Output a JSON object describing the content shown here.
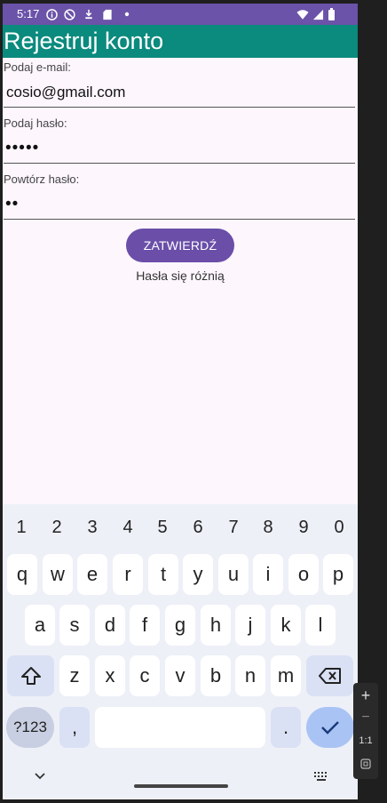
{
  "status": {
    "time": "5:17",
    "left_icons": [
      "info-icon",
      "block-icon",
      "notification-icon",
      "sd-card-icon",
      "dot-icon"
    ],
    "right_icons": [
      "wifi-icon",
      "signal-icon",
      "battery-icon"
    ]
  },
  "appbar": {
    "title": "Rejestruj konto"
  },
  "form": {
    "email_label": "Podaj e-mail:",
    "email_value": "cosio@gmail.com",
    "password_label": "Podaj hasło:",
    "password_value": "•••••",
    "confirm_label": "Powtórz hasło:",
    "confirm_value": "••",
    "submit_label": "ZATWIERDŹ",
    "message": "Hasła się różnią"
  },
  "keyboard": {
    "numbers": [
      "1",
      "2",
      "3",
      "4",
      "5",
      "6",
      "7",
      "8",
      "9",
      "0"
    ],
    "row1": [
      "q",
      "w",
      "e",
      "r",
      "t",
      "y",
      "u",
      "i",
      "o",
      "p"
    ],
    "row2": [
      "a",
      "s",
      "d",
      "f",
      "g",
      "h",
      "j",
      "k",
      "l"
    ],
    "row3": [
      "z",
      "x",
      "c",
      "v",
      "b",
      "n",
      "m"
    ],
    "mode_label": "?123",
    "comma_label": ",",
    "period_label": ".",
    "shift_icon": "shift-icon",
    "backspace_icon": "backspace-icon",
    "enter_icon": "checkmark-icon"
  },
  "navbar": {
    "back_icon": "chevron-down-icon",
    "keyboard_icon": "keyboard-icon"
  },
  "side_toolbar": {
    "zoom_in": "+",
    "zoom_out": "−",
    "ratio": "1:1"
  }
}
